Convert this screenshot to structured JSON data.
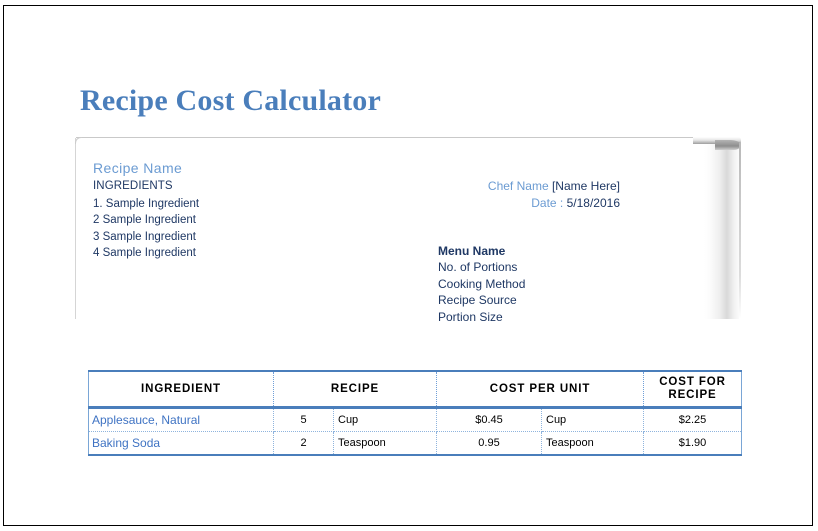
{
  "document": {
    "title": "Recipe Cost Calculator"
  },
  "header_panel": {
    "recipe_name_label": "Recipe Name",
    "ingredients_label": "INGREDIENTS",
    "ingredients": [
      "1. Sample Ingredient",
      "2 Sample Ingredient",
      "3 Sample Ingredient",
      "4 Sample Ingredient"
    ],
    "chef": {
      "label": "Chef Name",
      "value": "[Name Here]"
    },
    "date": {
      "label": "Date :",
      "value": "5/18/2016"
    },
    "meta_fields": [
      "Menu Name",
      "No. of Portions",
      "Cooking Method",
      "Recipe Source",
      "Portion Size"
    ]
  },
  "cost_table": {
    "columns": [
      "INGREDIENT",
      "RECIPE",
      "COST PER UNIT",
      "COST FOR RECIPE"
    ],
    "column_recipe_line1": "COST FOR",
    "column_recipe_line2": "RECIPE",
    "rows": [
      {
        "ingredient": "Applesauce, Natural",
        "quantity": "5",
        "unit": "Cup",
        "cost_per_unit": "$0.45",
        "cost_unit": "Cup",
        "cost_for_recipe": "$2.25"
      },
      {
        "ingredient": "Baking Soda",
        "quantity": "2",
        "unit": "Teaspoon",
        "cost_per_unit": "0.95",
        "cost_unit": "Teaspoon",
        "cost_for_recipe": "$1.90"
      }
    ]
  },
  "colors": {
    "title_blue": "#4a7ebb",
    "label_blue": "#6b9bd2",
    "text_navy": "#1f3864",
    "link_blue": "#3f73c3"
  }
}
